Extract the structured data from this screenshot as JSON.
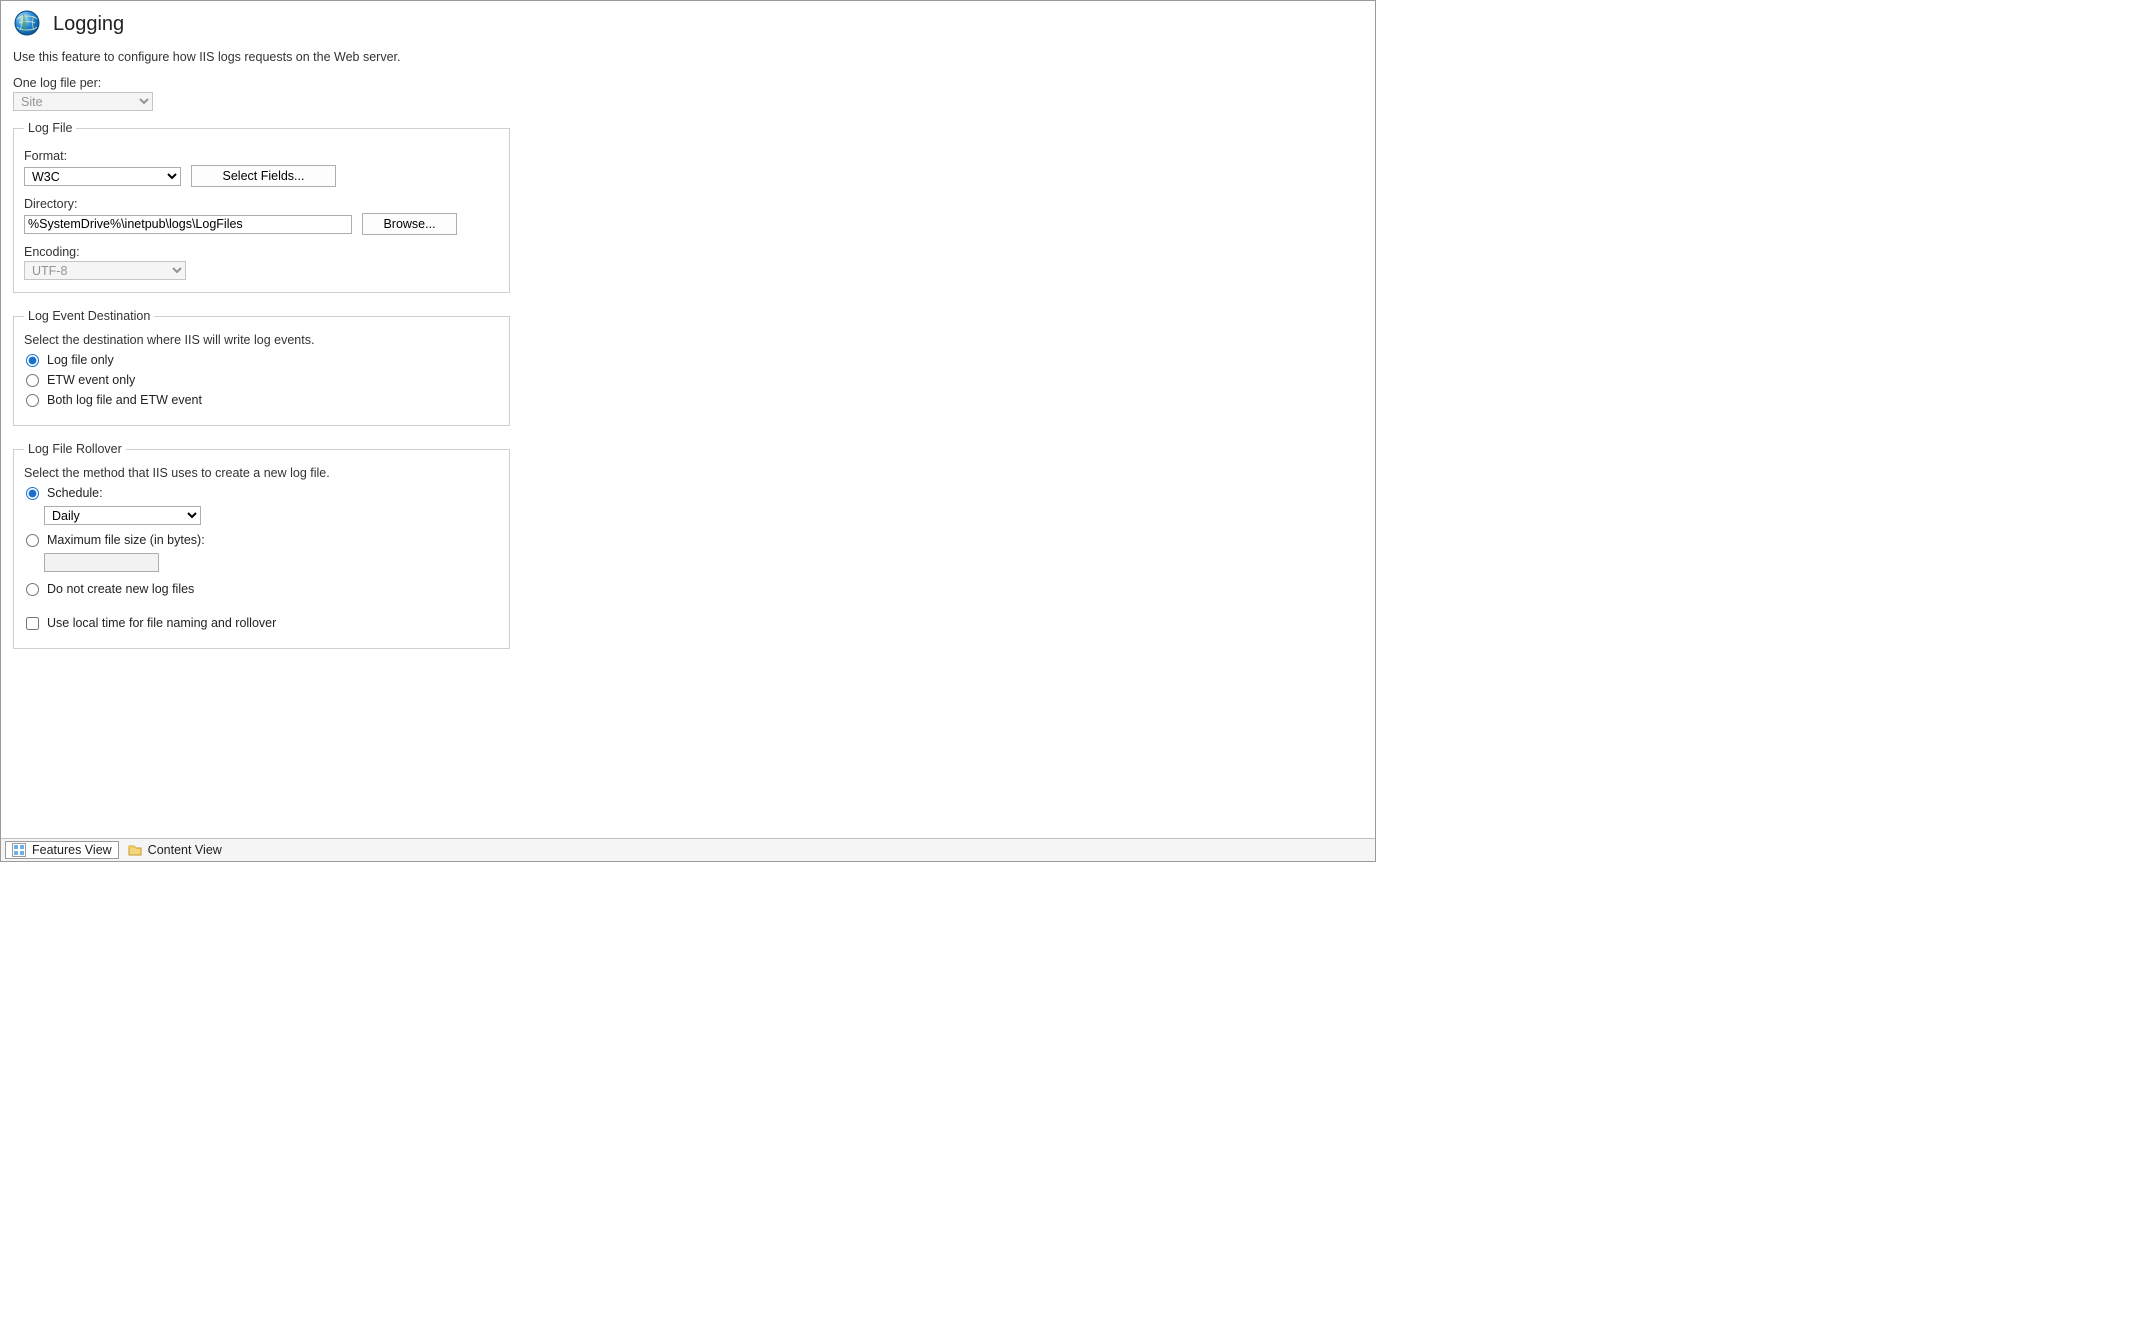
{
  "header": {
    "title": "Logging",
    "description": "Use this feature to configure how IIS logs requests on the Web server."
  },
  "one_per": {
    "label": "One log file per:",
    "value": "Site"
  },
  "log_file_group": {
    "legend": "Log File",
    "format_label": "Format:",
    "format_value": "W3C",
    "select_fields_button": "Select Fields...",
    "directory_label": "Directory:",
    "directory_value": "%SystemDrive%\\inetpub\\logs\\LogFiles",
    "browse_button": "Browse...",
    "encoding_label": "Encoding:",
    "encoding_value": "UTF-8"
  },
  "destination_group": {
    "legend": "Log Event Destination",
    "description": "Select the destination where IIS will write log events.",
    "options": {
      "log_file_only": "Log file only",
      "etw_only": "ETW event only",
      "both": "Both log file and ETW event"
    },
    "selected": "log_file_only"
  },
  "rollover_group": {
    "legend": "Log File Rollover",
    "description": "Select the method that IIS uses to create a new log file.",
    "options": {
      "schedule": "Schedule:",
      "max_size": "Maximum file size (in bytes):",
      "no_new": "Do not create new log files"
    },
    "selected": "schedule",
    "schedule_value": "Daily",
    "max_size_value": "",
    "local_time_label": "Use local time for file naming and rollover",
    "local_time_checked": false
  },
  "footer": {
    "features_view": "Features View",
    "content_view": "Content View"
  }
}
